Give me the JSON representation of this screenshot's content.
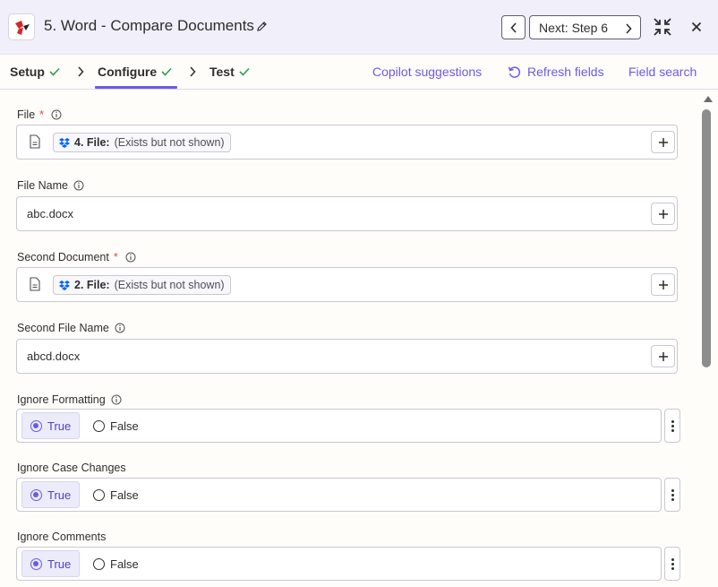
{
  "header": {
    "title": "5. Word - Compare Documents",
    "next_label": "Next: Step 6"
  },
  "tabs": [
    {
      "label": "Setup"
    },
    {
      "label": "Configure"
    },
    {
      "label": "Test"
    }
  ],
  "actions": {
    "copilot": "Copilot suggestions",
    "refresh": "Refresh fields",
    "field_search": "Field search"
  },
  "fields": {
    "file": {
      "label": "File",
      "required_mark": "*",
      "pill_bold": "4. File:",
      "pill_text": "(Exists but not shown)"
    },
    "file_name": {
      "label": "File Name",
      "value": "abc.docx"
    },
    "second_document": {
      "label": "Second Document",
      "required_mark": "*",
      "pill_bold": "2. File:",
      "pill_text": "(Exists but not shown)"
    },
    "second_file_name": {
      "label": "Second File Name",
      "value": "abcd.docx"
    },
    "ignore_formatting": {
      "label": "Ignore Formatting",
      "true_label": "True",
      "false_label": "False",
      "selected": "True"
    },
    "ignore_case_changes": {
      "label": "Ignore Case Changes",
      "true_label": "True",
      "false_label": "False",
      "selected": "True"
    },
    "ignore_comments": {
      "label": "Ignore Comments",
      "true_label": "True",
      "false_label": "False",
      "selected": "True"
    }
  },
  "colors": {
    "accent": "#695be8",
    "required": "#e8483f",
    "check": "#2e9e4f",
    "dropbox": "#0061fe"
  }
}
